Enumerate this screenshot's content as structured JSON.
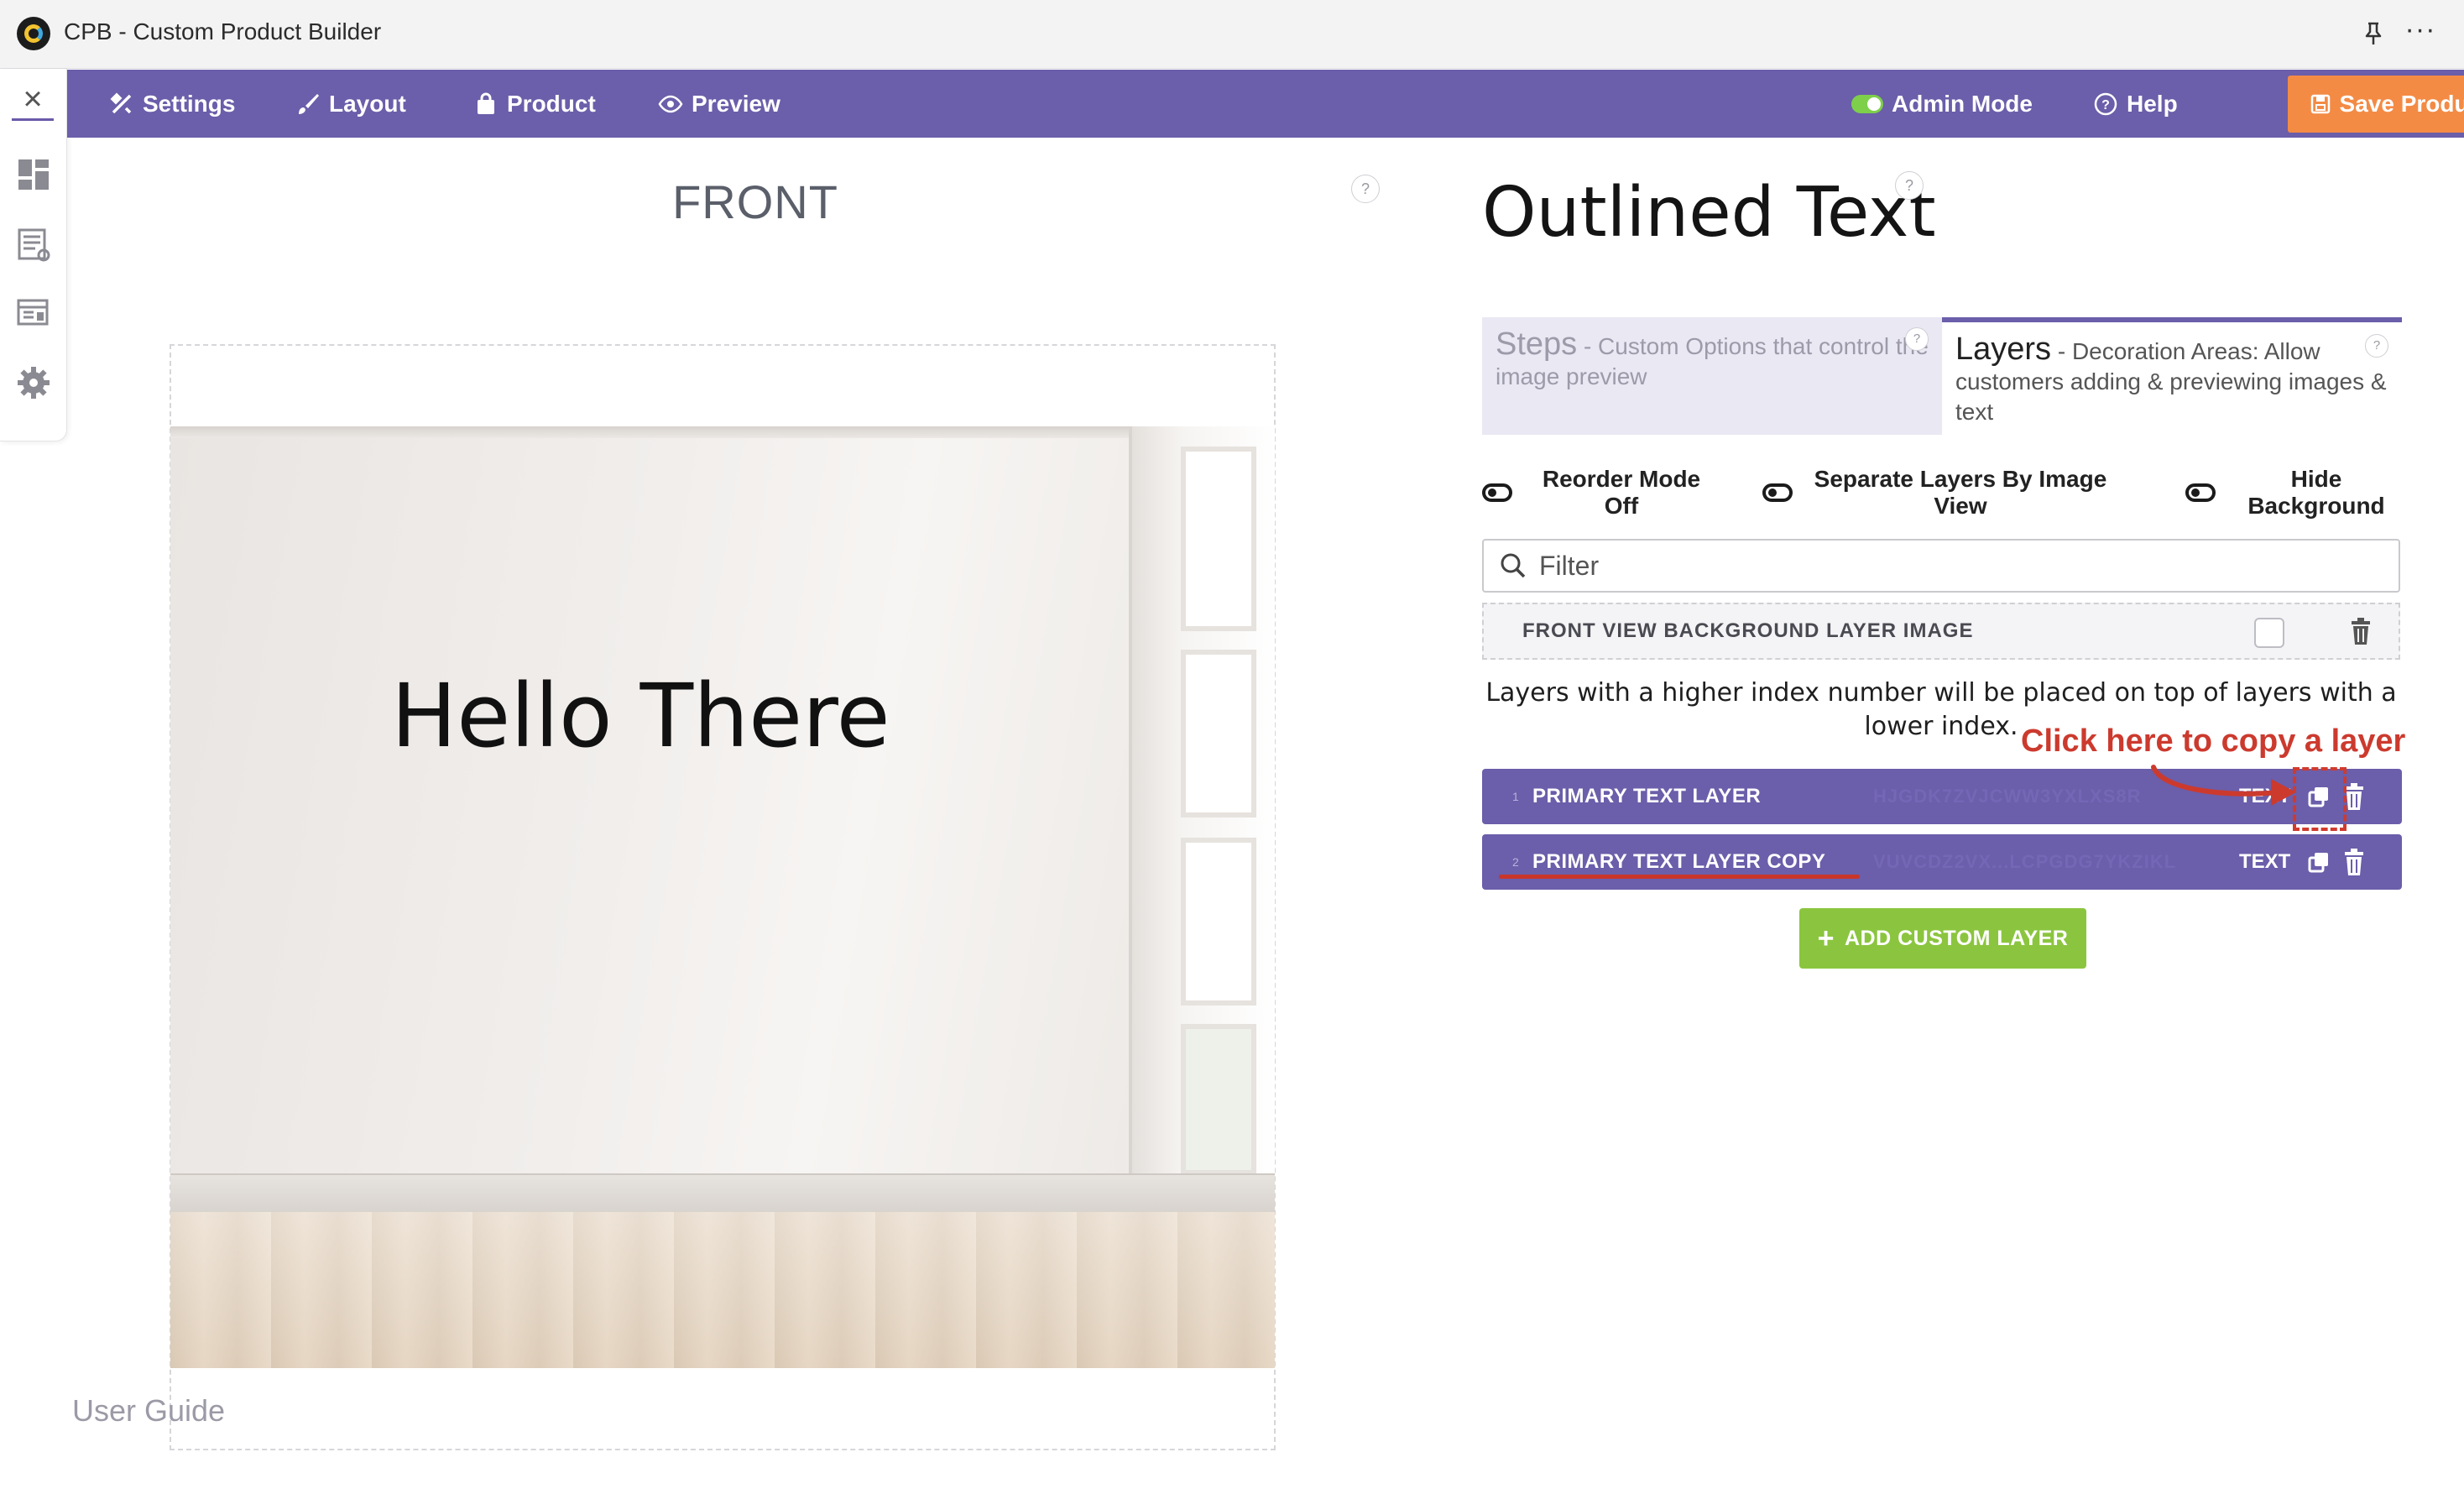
{
  "window": {
    "title": "CPB - Custom Product Builder"
  },
  "nav": {
    "settings": "Settings",
    "layout": "Layout",
    "product": "Product",
    "preview": "Preview",
    "admin_mode": "Admin Mode",
    "help": "Help",
    "save": "Save Product"
  },
  "canvas": {
    "view_title": "FRONT",
    "text_layer": "Hello There",
    "user_guide": "User Guide",
    "help_mark": "?"
  },
  "panel": {
    "title": "Outlined Text",
    "help_mark": "?",
    "tabs": {
      "steps_title": "Steps",
      "steps_desc": " - Custom Options that control the image preview",
      "layers_title": "Layers",
      "layers_desc": " - Decoration Areas: Allow customers adding & previewing images & text"
    },
    "toggles": {
      "reorder": "Reorder Mode Off",
      "separate": "Separate Layers By Image View",
      "hide_bg": "Hide Background"
    },
    "filter_placeholder": "Filter",
    "background_layer": "FRONT VIEW BACKGROUND LAYER IMAGE",
    "info": "Layers with a higher index number will be placed on top of layers with a lower index.",
    "layers": [
      {
        "index": "1",
        "name": "PRIMARY TEXT LAYER",
        "code": "HJGDK7ZVJCWW3YXLXS8R",
        "type": "TEXT"
      },
      {
        "index": "2",
        "name": "PRIMARY TEXT LAYER COPY",
        "code": "VUVCDZ2VX...LCPGDG7YKZIKL",
        "type": "TEXT"
      }
    ],
    "add_button": "ADD CUSTOM LAYER"
  },
  "annotation": {
    "callout": "Click here to copy a layer",
    "color": "#cc3a2e"
  },
  "colors": {
    "nav_bg": "#6b5eaa",
    "save_bg": "#f38b45",
    "add_bg": "#8bc53f"
  }
}
